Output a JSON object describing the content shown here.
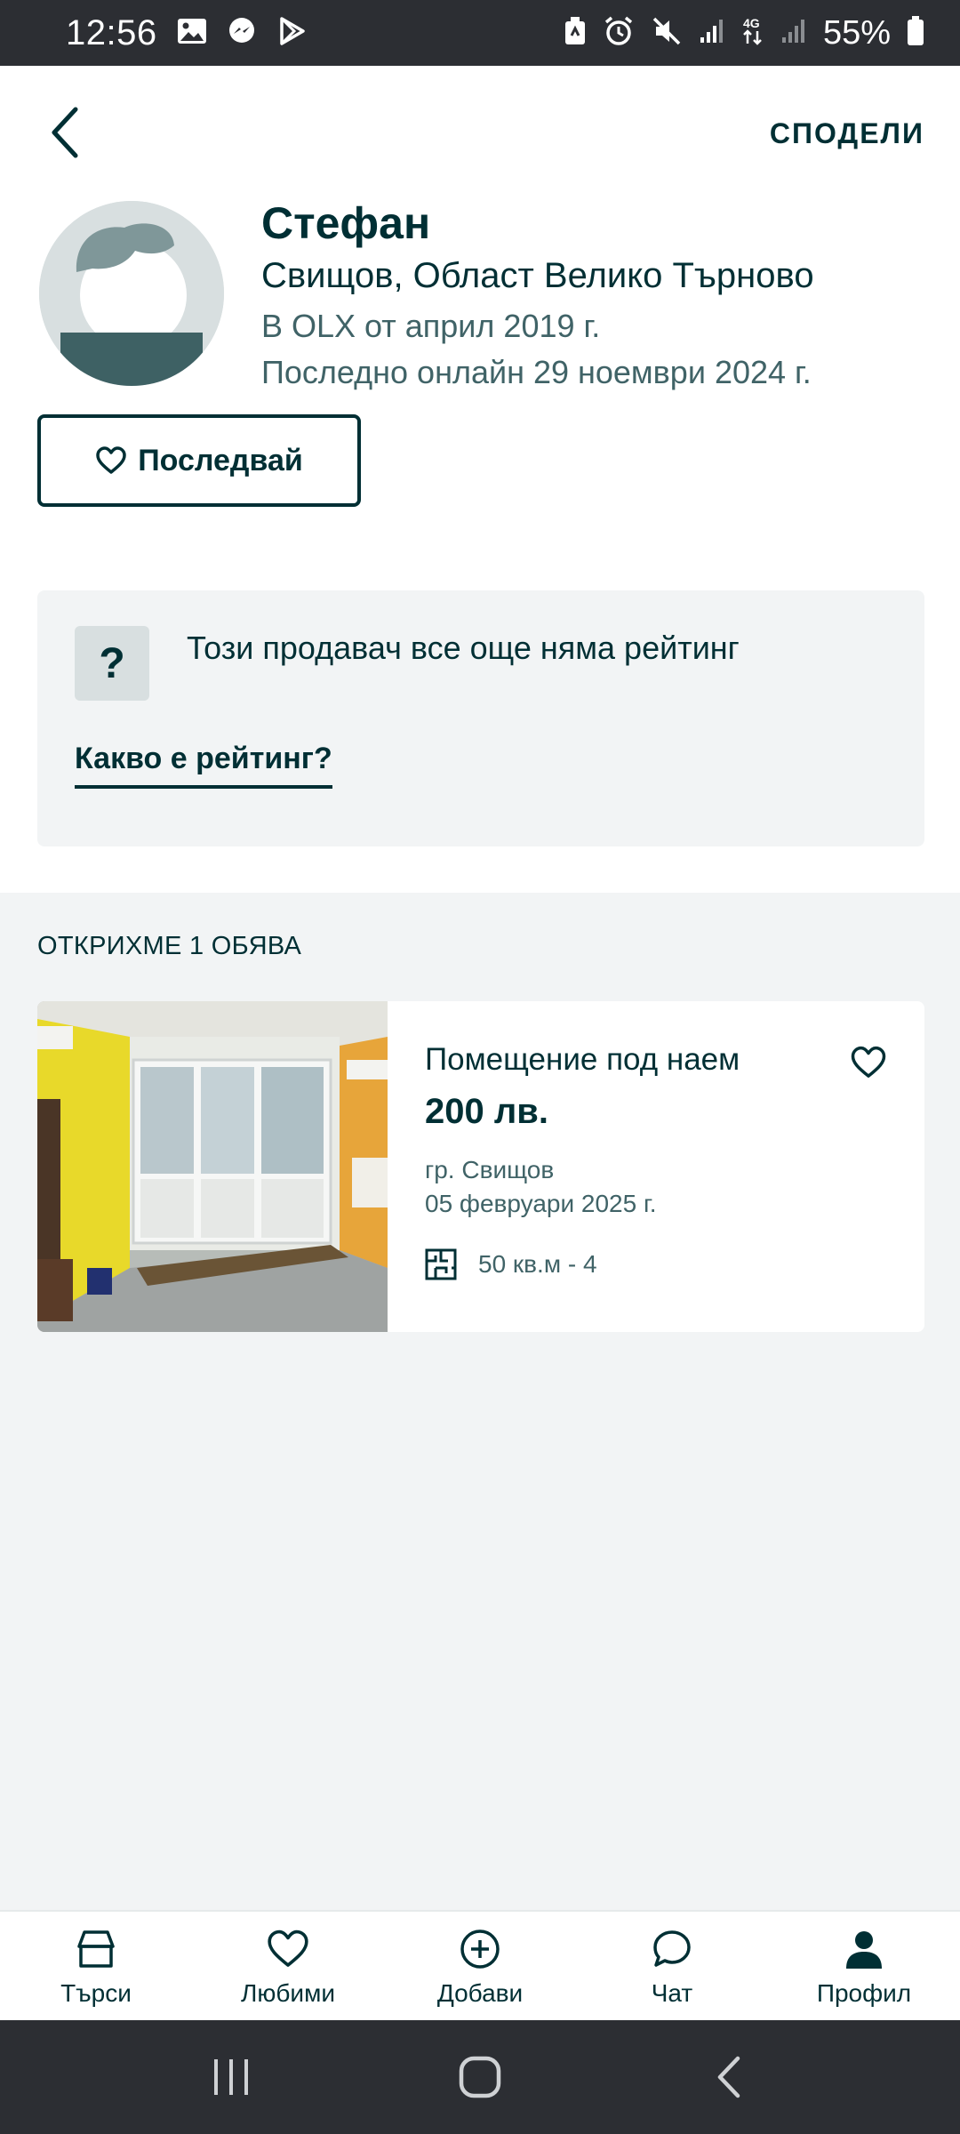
{
  "status_bar": {
    "time": "12:56",
    "battery": "55%"
  },
  "header": {
    "share_label": "СПОДЕЛИ"
  },
  "seller": {
    "name": "Стефан",
    "location": "Свищов, Област Велико Търново",
    "since": "В OLX от април 2019 г.",
    "last_online": "Последно онлайн 29 ноември 2024 г.",
    "follow_label": "Последвай"
  },
  "rating": {
    "icon_text": "?",
    "text": "Този продавач все още няма рейтинг",
    "link": "Какво е рейтинг?"
  },
  "listings": {
    "found_label": "ОТКРИХМЕ 1 ОБЯВА",
    "items": [
      {
        "title": "Помещение под наем",
        "price": "200 лв.",
        "location": "гр. Свищов",
        "date": "05 февруари 2025 г.",
        "area": "50 кв.м - 4"
      }
    ]
  },
  "bottom_nav": {
    "items": [
      {
        "label": "Търси",
        "icon": "home-icon"
      },
      {
        "label": "Любими",
        "icon": "heart-icon"
      },
      {
        "label": "Добави",
        "icon": "plus-circle-icon"
      },
      {
        "label": "Чат",
        "icon": "chat-icon"
      },
      {
        "label": "Профил",
        "icon": "person-icon"
      }
    ]
  },
  "colors": {
    "primary": "#002f34",
    "secondary_text": "#406367",
    "background": "#f2f4f5",
    "avatar_bg": "#d8dfe0",
    "system_bar": "#2c2e33"
  }
}
